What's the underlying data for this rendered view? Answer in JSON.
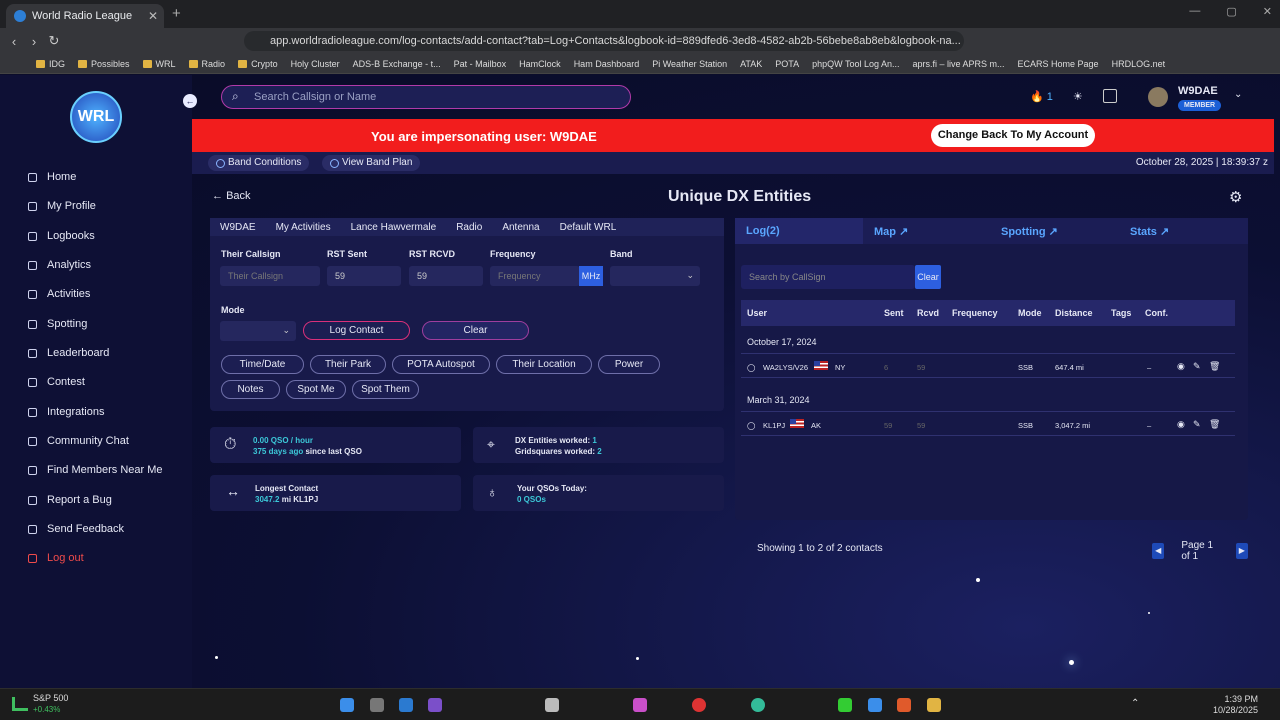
{
  "browser": {
    "tab_title": "World Radio League",
    "url": "app.worldradioleague.com/log-contacts/add-contact?tab=Log+Contacts&logbook-id=889dfed6-3ed8-4582-ab2b-56bebe8ab8eb&logbook-na...",
    "bookmarks": [
      "IDG",
      "Possibles",
      "WRL",
      "Radio",
      "Crypto",
      "Holy Cluster",
      "ADS-B Exchange - t...",
      "Pat - Mailbox",
      "HamClock",
      "Ham Dashboard",
      "Pi Weather Station",
      "ATAK",
      "POTA",
      "phpQW Tool Log An...",
      "aprs.fi – live APRS m...",
      "ECARS Home Page",
      "HRDLOG.net"
    ]
  },
  "sidebar": {
    "logo": "WRL",
    "items": [
      "Home",
      "My Profile",
      "Logbooks",
      "Analytics",
      "Activities",
      "Spotting",
      "Leaderboard",
      "Contest",
      "Integrations",
      "Community Chat",
      "Find Members Near Me",
      "Report a Bug",
      "Send Feedback",
      "Log out"
    ]
  },
  "header": {
    "search_placeholder": "Search Callsign or Name",
    "notif_count": "1",
    "username": "W9DAE",
    "badge": "MEMBER"
  },
  "banner": {
    "text": "You are impersonating user: W9DAE",
    "button": "Change Back To My Account"
  },
  "subbar": {
    "band_conditions": "Band Conditions",
    "band_plan": "View Band Plan",
    "datetime": "October 28, 2025 | 18:39:37 z"
  },
  "page": {
    "back": "Back",
    "title": "Unique DX Entities"
  },
  "form": {
    "crumbs": [
      "W9DAE",
      "My Activities",
      "Lance Hawvermale",
      "Radio",
      "Antenna",
      "Default WRL"
    ],
    "their_callsign_label": "Their Callsign",
    "their_callsign_placeholder": "Their Callsign",
    "rst_sent_label": "RST Sent",
    "rst_sent": "59",
    "rst_rcvd_label": "RST RCVD",
    "rst_rcvd": "59",
    "frequency_label": "Frequency",
    "frequency_placeholder": "Frequency",
    "freq_unit": "MHz",
    "band_label": "Band",
    "mode_label": "Mode",
    "log_contact": "Log Contact",
    "clear": "Clear",
    "options": [
      "Time/Date",
      "Their Park",
      "POTA Autospot",
      "Their Location",
      "Power"
    ],
    "options2": [
      "Notes",
      "Spot Me",
      "Spot Them"
    ]
  },
  "stats": {
    "qso_rate": "0.00 QSO / hour",
    "last_qso": "375 days ago",
    "last_qso_suffix": "since last QSO",
    "dx_label": "DX Entities worked:",
    "dx_value": "1",
    "grid_label": "Gridsquares worked:",
    "grid_value": "2",
    "longest_label": "Longest Contact",
    "longest_value": "3047.2",
    "longest_suffix": "mi KL1PJ",
    "today_label": "Your QSOs Today:",
    "today_value": "0 QSOs"
  },
  "right": {
    "tabs": [
      "Log(2)",
      "Map",
      "Spotting",
      "Stats"
    ],
    "search_placeholder": "Search by CallSign",
    "clear": "Clear",
    "columns": [
      "User",
      "Sent",
      "Rcvd",
      "Frequency",
      "Mode",
      "Distance",
      "Tags",
      "Conf."
    ],
    "groups": [
      "October 17, 2024",
      "March 31, 2024"
    ],
    "rows": [
      {
        "call": "WA2LYS/V26",
        "state": "NY",
        "sent": "6",
        "rcvd": "59",
        "mode": "SSB",
        "distance": "647.4 mi",
        "conf": "–"
      },
      {
        "call": "KL1PJ",
        "state": "AK",
        "sent": "59",
        "rcvd": "59",
        "mode": "SSB",
        "distance": "3,047.2 mi",
        "conf": "–"
      }
    ],
    "footer": "Showing 1 to 2 of 2 contacts",
    "page": "Page 1 of 1"
  },
  "taskbar": {
    "ticker": "S&P 500",
    "change": "+0.43%",
    "time": "1:39 PM",
    "date": "10/28/2025"
  }
}
